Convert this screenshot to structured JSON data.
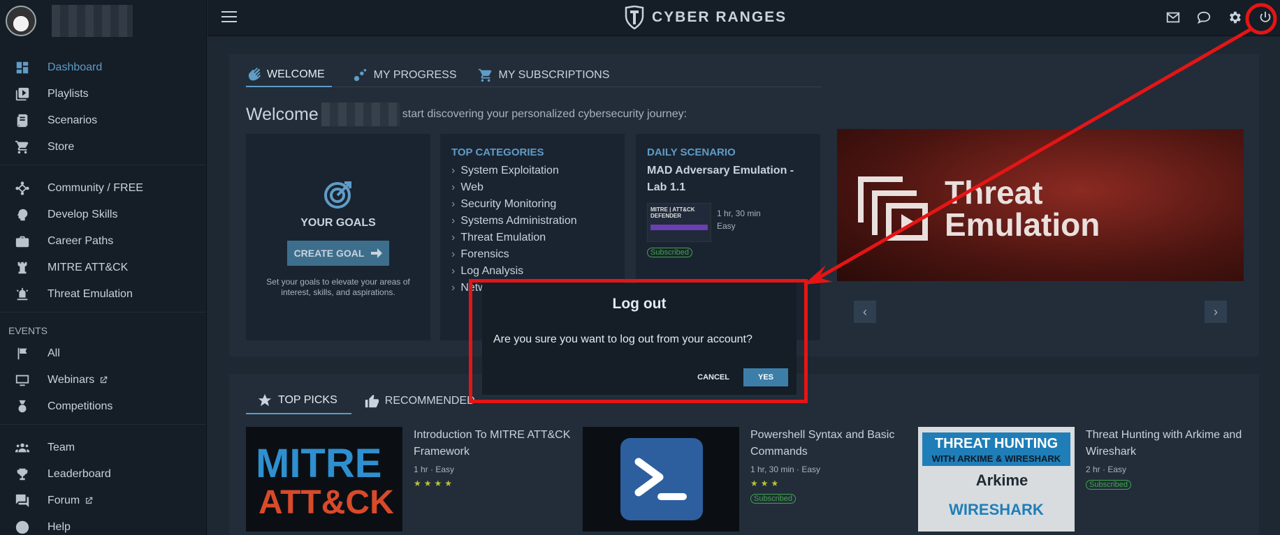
{
  "brand": {
    "name": "CYBER RANGES"
  },
  "sidebar": {
    "main": [
      {
        "label": "Dashboard",
        "icon": "dashboard-icon",
        "active": true
      },
      {
        "label": "Playlists",
        "icon": "playlist-icon"
      },
      {
        "label": "Scenarios",
        "icon": "scenarios-icon"
      },
      {
        "label": "Store",
        "icon": "cart-icon"
      }
    ],
    "skills": [
      {
        "label": "Community / FREE",
        "icon": "community-icon"
      },
      {
        "label": "Develop Skills",
        "icon": "brain-icon"
      },
      {
        "label": "Career Paths",
        "icon": "briefcase-icon"
      },
      {
        "label": "MITRE ATT&CK",
        "icon": "rook-icon"
      },
      {
        "label": "Threat Emulation",
        "icon": "siren-icon"
      }
    ],
    "events_title": "EVENTS",
    "events": [
      {
        "label": "All",
        "icon": "flag-icon"
      },
      {
        "label": "Webinars",
        "icon": "monitor-icon",
        "external": true
      },
      {
        "label": "Competitions",
        "icon": "medal-icon"
      }
    ],
    "social": [
      {
        "label": "Team",
        "icon": "team-icon"
      },
      {
        "label": "Leaderboard",
        "icon": "trophy-icon"
      },
      {
        "label": "Forum",
        "icon": "forum-icon",
        "external": true
      },
      {
        "label": "Help",
        "icon": "help-icon"
      }
    ]
  },
  "topbar": {
    "icons": [
      "mail-icon",
      "chat-icon",
      "settings-icon",
      "power-icon"
    ]
  },
  "welcome": {
    "tabs": [
      "WELCOME",
      "MY PROGRESS",
      "MY SUBSCRIPTIONS"
    ],
    "greeting": "Welcome",
    "subtitle": "start discovering your personalized cybersecurity journey:",
    "goals": {
      "title": "YOUR GOALS",
      "button": "CREATE GOAL",
      "hint": "Set your goals to elevate your areas of interest, skills, and aspirations."
    },
    "categories": {
      "title": "TOP CATEGORIES",
      "items": [
        "System Exploitation",
        "Web",
        "Security Monitoring",
        "Systems Administration",
        "Threat Emulation",
        "Forensics",
        "Log Analysis",
        "Netw"
      ]
    },
    "daily": {
      "title": "DAILY SCENARIO",
      "name": "MAD Adversary Emulation - Lab 1.1",
      "thumb_line1": "MITRE | ATT&CK",
      "thumb_line2": "DEFENDER",
      "duration": "1 hr, 30 min",
      "difficulty": "Easy",
      "badge": "Subscribed"
    },
    "banner": {
      "line1": "Threat",
      "line2": "Emulation"
    },
    "prev": "‹",
    "next": "›"
  },
  "picks": {
    "tabs": [
      "TOP PICKS",
      "RECOMMENDED"
    ],
    "items": [
      {
        "title": "Introduction To MITRE ATT&CK Framework",
        "duration": "1 hr",
        "difficulty": "Easy",
        "stars": "★★★★",
        "img_line1": "MITRE",
        "img_line2": "ATT&CK"
      },
      {
        "title": "Powershell Syntax and Basic Commands",
        "duration": "1 hr, 30 min",
        "difficulty": "Easy",
        "stars": "★★★",
        "badge": "Subscribed"
      },
      {
        "title": "Threat Hunting with Arkime and Wireshark",
        "duration": "2 hr",
        "difficulty": "Easy",
        "badge": "Subscribed",
        "img_line1": "THREAT HUNTING",
        "img_line2": "WITH ARKIME & WIRESHARK",
        "img_line3": "Arkime",
        "img_line4": "WIRESHARK"
      }
    ]
  },
  "modal": {
    "title": "Log out",
    "body": "Are you sure you want to log out from your account?",
    "cancel": "CANCEL",
    "yes": "YES"
  },
  "colors": {
    "accent": "#5f9cc7",
    "annotation": "#e51515",
    "success": "#3fa64a"
  }
}
